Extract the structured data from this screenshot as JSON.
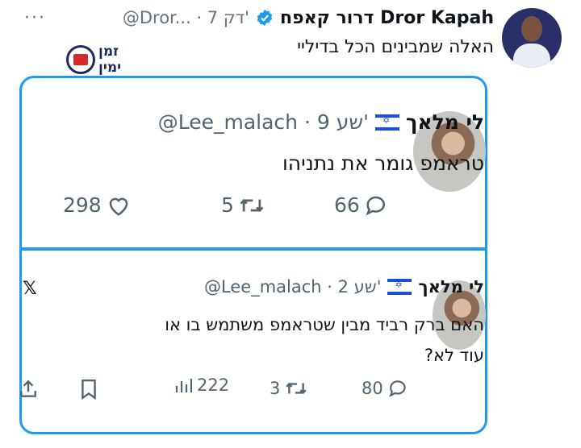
{
  "post": {
    "author_name": "דרור קאפח Dror Kapah",
    "handle_time": "@Dror... · 7 דק'",
    "more_label": "···",
    "text": "האלה שמבינים הכל בדיליי",
    "verified_icon": "verified-badge-icon",
    "logo": {
      "line1": "זמן",
      "line2": "ימין"
    }
  },
  "quoted": [
    {
      "name": "לי מלאך",
      "flag_icon": "israel-flag-icon",
      "handle_time": "@Lee_malach · 9 שע'",
      "text": "טראמפ גומר את נתניהו",
      "replies": "66",
      "retweets": "5",
      "likes": "298"
    },
    {
      "name": "לי מלאך",
      "flag_icon": "israel-flag-icon",
      "handle_time": "@Lee_malach · 2 שע'",
      "x_logo": "𝕏",
      "text": "האם ברק רביד מבין שטראמפ משתמש בו או עוד לא?",
      "replies": "80",
      "retweets": "3",
      "views": "222"
    }
  ],
  "colors": {
    "accent": "#1d9bf0",
    "text": "#0f1419",
    "muted": "#536471"
  }
}
